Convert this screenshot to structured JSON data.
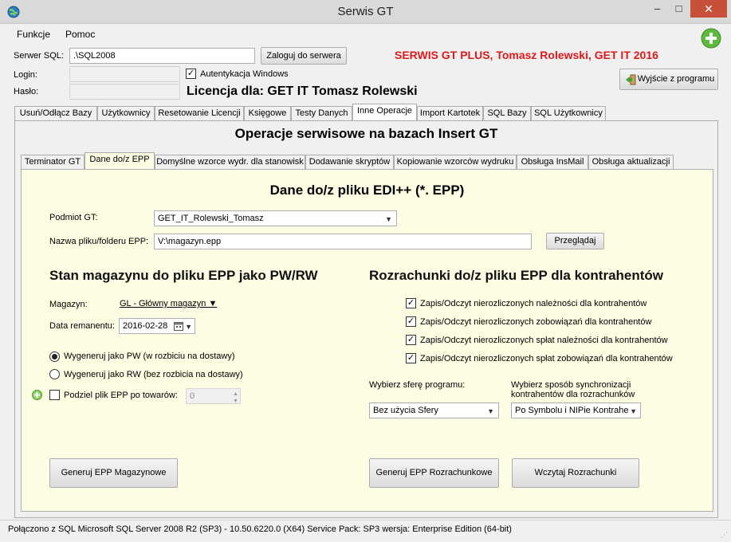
{
  "window": {
    "title": "Serwis GT",
    "minimize": "–",
    "maximize": "□",
    "close": "✕"
  },
  "menu": {
    "items": [
      "Funkcje",
      "Pomoc"
    ]
  },
  "login": {
    "server_label": "Serwer SQL:",
    "server_value": ".\\SQL2008",
    "connect_button": "Zaloguj do serwera",
    "login_label": "Login:",
    "password_label": "Hasło:",
    "windows_auth_label": "Autentykacja Windows",
    "windows_auth_checked": true,
    "license_text": "Licencja dla: GET IT Tomasz Rolewski"
  },
  "brand": {
    "text": "SERWIS GT PLUS, Tomasz Rolewski, GET IT 2016",
    "color": "#e0191a"
  },
  "exit_button": "Wyjście z programu",
  "main_tabs": [
    "Usuń/Odłącz Bazy",
    "Użytkownicy",
    "Resetowanie Licencji",
    "Księgowe",
    "Testy Danych",
    "Inne Operacje",
    "Import Kartotek",
    "SQL Bazy",
    "SQL Użytkownicy"
  ],
  "main_active_tab": "Inne Operacje",
  "section_title": "Operacje serwisowe na bazach Insert GT",
  "sub_tabs": [
    "Terminator GT",
    "Dane do/z EPP",
    "Domyślne wzorce wydr. dla stanowisk",
    "Dodawanie skryptów",
    "Kopiowanie wzorców wydruku",
    "Obsługa InsMail",
    "Obsługa aktualizacji"
  ],
  "sub_active_tab": "Dane do/z EPP",
  "epp": {
    "title": "Dane do/z pliku EDI++ (*. EPP)",
    "entity_label": "Podmiot GT:",
    "entity_value": "GET_IT_Rolewski_Tomasz",
    "file_label": "Nazwa pliku/folderu EPP:",
    "file_value": "V:\\magazyn.epp",
    "browse_button": "Przeglądaj",
    "panel_bg": "#fdfde4"
  },
  "warehouse": {
    "heading": "Stan magazynu do pliku EPP jako PW/RW",
    "magazyn_label": "Magazyn:",
    "magazyn_value": "GL - Główny magazyn ▼",
    "date_label": "Data remanentu:",
    "date_value": "2016-02-28",
    "radio_pw": "Wygeneruj jako PW (w rozbiciu na dostawy)",
    "radio_rw": "Wygeneruj jako RW (bez rozbicia na dostawy)",
    "selected_radio": "pw",
    "split_label": "Podziel plik EPP po towarów:",
    "split_checked": false,
    "split_value": "0",
    "generate_button": "Generuj EPP Magazynowe"
  },
  "settlements": {
    "heading": "Rozrachunki do/z pliku EPP dla kontrahentów",
    "checks": [
      "Zapis/Odczyt nierozliczonych należności dla kontrahentów",
      "Zapis/Odczyt nierozliczonych zobowiązań dla kontrahentów",
      "Zapis/Odczyt nierozliczonych spłat należności dla kontrahentów",
      "Zapis/Odczyt nierozliczonych spłat zobowiązań dla kontrahentów"
    ],
    "sphere_label": "Wybierz sferę programu:",
    "sphere_value": "Bez użycia Sfery",
    "sync_label_1": "Wybierz sposób synchronizacji",
    "sync_label_2": "kontrahentów dla rozrachunków",
    "sync_value": "Po Symbolu i NIPie Kontraher",
    "generate_button": "Generuj EPP Rozrachunkowe",
    "load_button": "Wczytaj Rozrachunki"
  },
  "status_bar": "Połączono z SQL  Microsoft SQL Server 2008 R2 (SP3) - 10.50.6220.0 (X64)  Service Pack: SP3  wersja: Enterprise Edition (64-bit)"
}
